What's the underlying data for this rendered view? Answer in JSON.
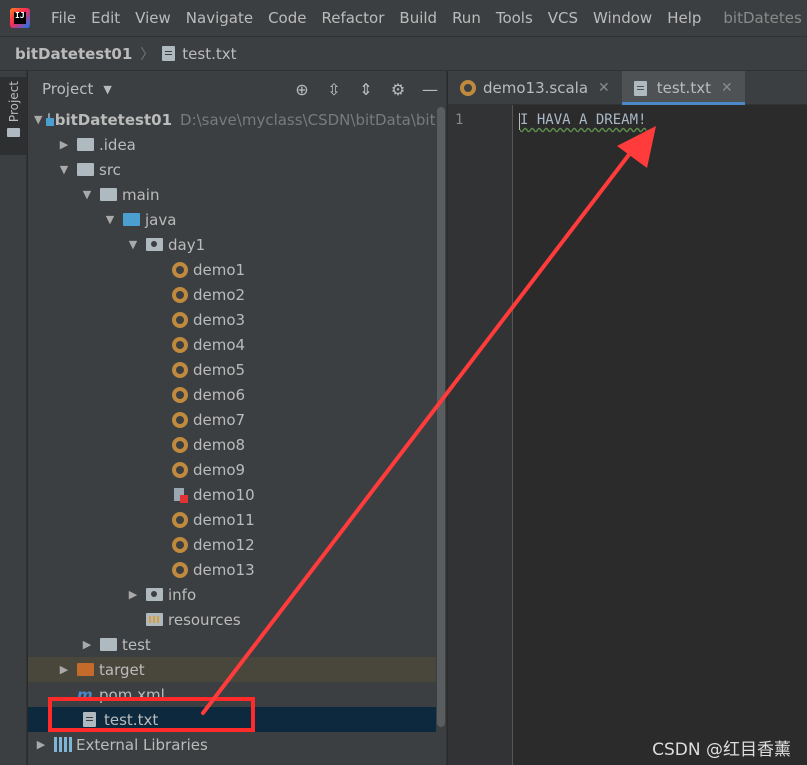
{
  "menubar": {
    "items": [
      "File",
      "Edit",
      "View",
      "Navigate",
      "Code",
      "Refactor",
      "Build",
      "Run",
      "Tools",
      "VCS",
      "Window",
      "Help"
    ],
    "window_title": "bitDatetes"
  },
  "breadcrumb": {
    "project": "bitDatetest01",
    "file": "test.txt"
  },
  "stripe": {
    "project_tab": "Project"
  },
  "panel": {
    "title": "Project",
    "tree": {
      "root": {
        "name": "bitDatetest01",
        "path": "D:\\save\\myclass\\CSDN\\bitData\\bitD"
      },
      "idea": ".idea",
      "src": "src",
      "main": "main",
      "java": "java",
      "day1": "day1",
      "demos": [
        "demo1",
        "demo2",
        "demo3",
        "demo4",
        "demo5",
        "demo6",
        "demo7",
        "demo8",
        "demo9",
        "demo10",
        "demo11",
        "demo12",
        "demo13"
      ],
      "info": "info",
      "resources": "resources",
      "test": "test",
      "target": "target",
      "pom": "pom.xml",
      "testtxt": "test.txt",
      "extlibs": "External Libraries"
    }
  },
  "editor": {
    "tabs": [
      {
        "label": "demo13.scala",
        "icon": "scala-icon",
        "active": false
      },
      {
        "label": "test.txt",
        "icon": "text-file-icon",
        "active": true
      }
    ],
    "line_number": "1",
    "content": "I HAVA A DREAM!"
  },
  "watermark": "CSDN @红目香薰",
  "colors": {
    "annotation_red": "#ff2a2a",
    "tab_accent": "#4a88c7",
    "selection": "#0d293e"
  }
}
